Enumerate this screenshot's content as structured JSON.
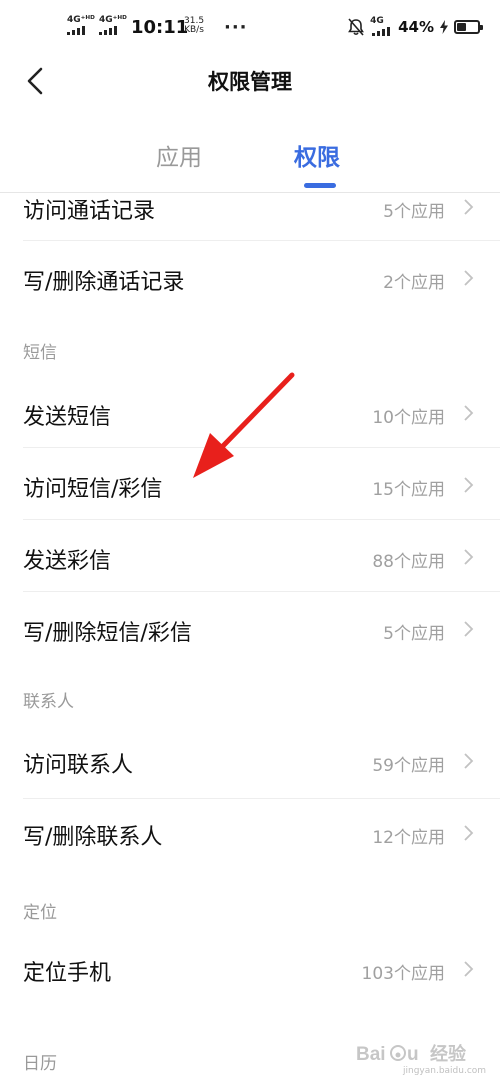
{
  "status_bar": {
    "sim1": "4G⁺ᴴᴰ",
    "sim2": "4G⁺ᴴᴰ",
    "time": "10:11",
    "speed_value": "31.5",
    "speed_unit": "KB/s",
    "more": "···",
    "net_type": "4G",
    "battery_percent": "44%",
    "battery_level": 0.44
  },
  "header": {
    "title": "权限管理"
  },
  "tabs": [
    {
      "label": "应用",
      "active": false
    },
    {
      "label": "权限",
      "active": true
    }
  ],
  "list": {
    "items": [
      {
        "label": "访问通话记录",
        "count": "5个应用"
      },
      {
        "label": "写/删除通话记录",
        "count": "2个应用"
      }
    ],
    "sms": {
      "header": "短信",
      "items": [
        {
          "label": "发送短信",
          "count": "10个应用"
        },
        {
          "label": "访问短信/彩信",
          "count": "15个应用"
        },
        {
          "label": "发送彩信",
          "count": "88个应用"
        },
        {
          "label": "写/删除短信/彩信",
          "count": "5个应用"
        }
      ]
    },
    "contacts": {
      "header": "联系人",
      "items": [
        {
          "label": "访问联系人",
          "count": "59个应用"
        },
        {
          "label": "写/删除联系人",
          "count": "12个应用"
        }
      ]
    },
    "location": {
      "header": "定位",
      "items": [
        {
          "label": "定位手机",
          "count": "103个应用"
        }
      ]
    },
    "calendar": {
      "header": "日历"
    }
  },
  "annotation": {
    "color": "#e8201c"
  },
  "watermark": {
    "logo": "Baidu",
    "text": "经验",
    "url": "jingyan.baidu.com"
  },
  "colors": {
    "accent": "#3a6ce0",
    "secondary_text": "#a0a0a0"
  }
}
